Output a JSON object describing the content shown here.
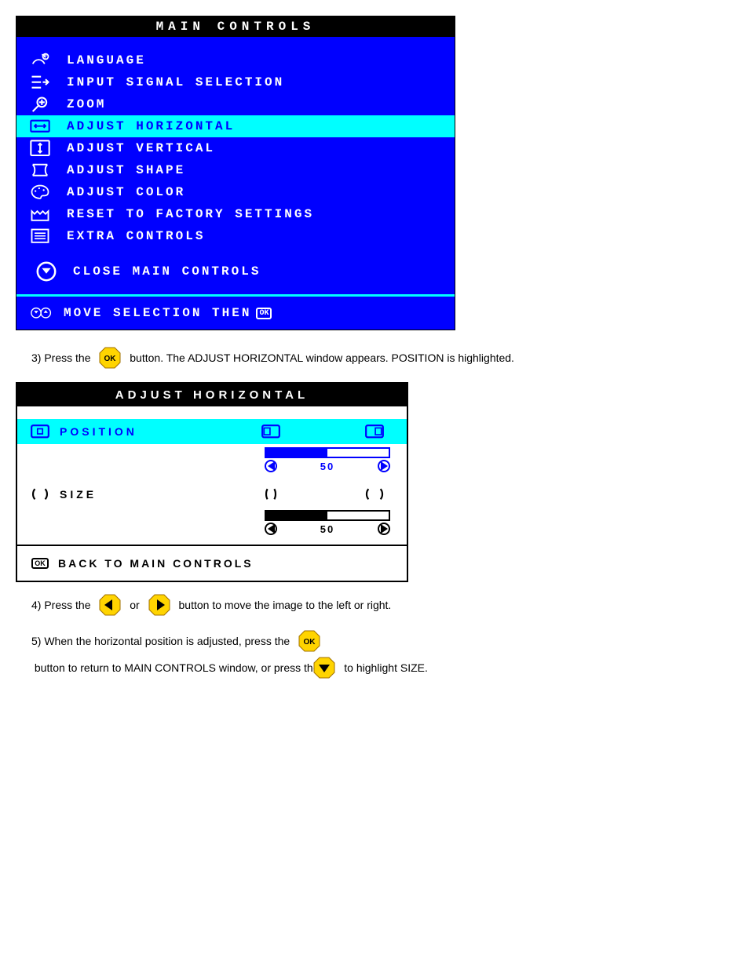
{
  "main_panel": {
    "title": "MAIN CONTROLS",
    "items": [
      {
        "label": "LANGUAGE",
        "icon": "language-icon",
        "selected": false
      },
      {
        "label": "INPUT SIGNAL SELECTION",
        "icon": "input-signal-icon",
        "selected": false
      },
      {
        "label": "ZOOM",
        "icon": "zoom-icon",
        "selected": false
      },
      {
        "label": "ADJUST HORIZONTAL",
        "icon": "adjust-horizontal-icon",
        "selected": true
      },
      {
        "label": "ADJUST VERTICAL",
        "icon": "adjust-vertical-icon",
        "selected": false
      },
      {
        "label": "ADJUST SHAPE",
        "icon": "adjust-shape-icon",
        "selected": false
      },
      {
        "label": "ADJUST COLOR",
        "icon": "adjust-color-icon",
        "selected": false
      },
      {
        "label": "RESET TO FACTORY SETTINGS",
        "icon": "factory-reset-icon",
        "selected": false
      },
      {
        "label": "EXTRA CONTROLS",
        "icon": "extra-controls-icon",
        "selected": false
      }
    ],
    "close_label": "CLOSE MAIN CONTROLS",
    "footer_label": "MOVE SELECTION THEN",
    "footer_ok": "OK"
  },
  "instr1": {
    "prefix": "3) Press the ",
    "suffix": " button. The ADJUST HORIZONTAL window appears. POSITION is highlighted."
  },
  "adjust_panel": {
    "title": "ADJUST HORIZONTAL",
    "rows": [
      {
        "label": "POSITION",
        "icon": "position-icon",
        "value": 50,
        "selected": true
      },
      {
        "label": "SIZE",
        "icon": "size-icon",
        "value": 50,
        "selected": false
      }
    ],
    "back_label": "BACK TO MAIN CONTROLS",
    "back_ok": "OK"
  },
  "instr2": {
    "prefix": "4) Press the ",
    "mid": " or ",
    "suffix": " button to move the image to the left or right."
  },
  "instr3": {
    "prefix": "5) When the horizontal position is adjusted, press the ",
    "mid": " button to return to MAIN CONTROLS window, or press the ",
    "suffix": " to highlight SIZE."
  }
}
